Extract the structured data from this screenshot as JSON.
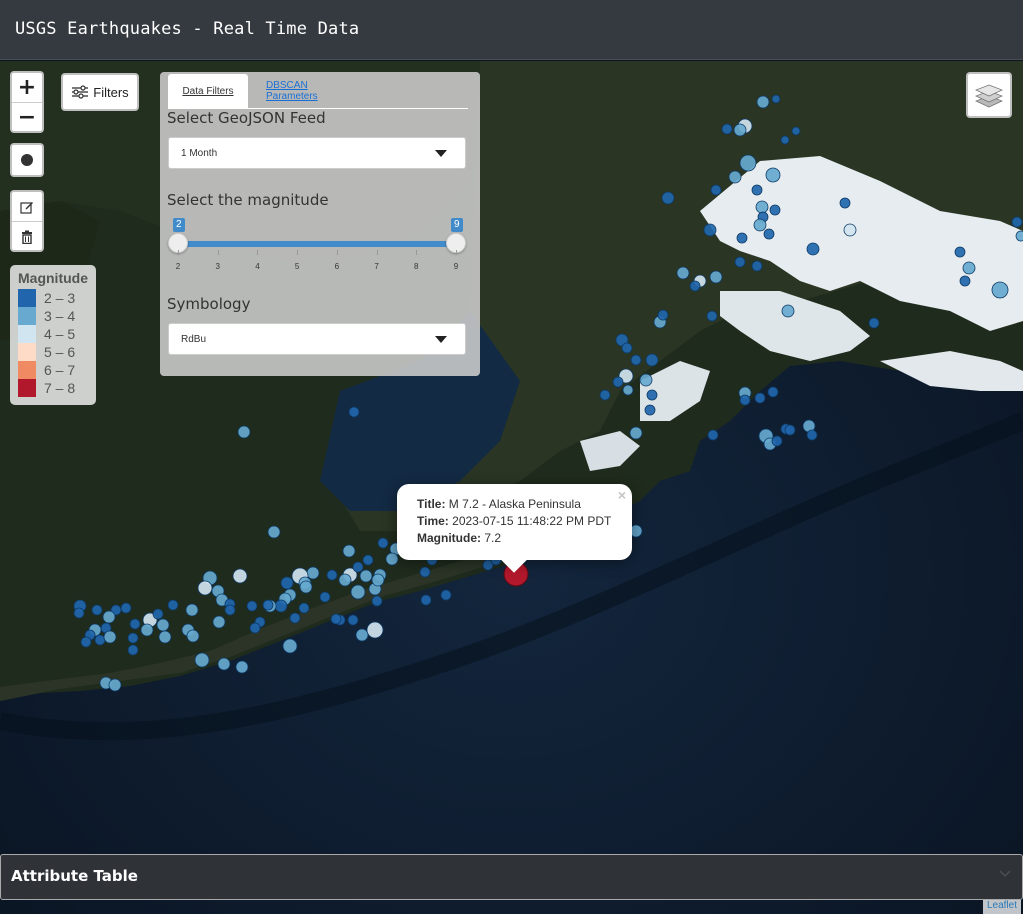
{
  "navbar": {
    "title": "USGS Earthquakes - Real Time Data"
  },
  "map_controls": {
    "zoom_in": "+",
    "zoom_out": "−",
    "filters_label": "Filters"
  },
  "legend": {
    "title": "Magnitude",
    "items": [
      {
        "label": "2 – 3",
        "color": "#2166ac"
      },
      {
        "label": "3 – 4",
        "color": "#67a9cf"
      },
      {
        "label": "4 – 5",
        "color": "#d1e5f0"
      },
      {
        "label": "5 – 6",
        "color": "#fddbc7"
      },
      {
        "label": "6 – 7",
        "color": "#ef8a62"
      },
      {
        "label": "7 – 8",
        "color": "#b2182b"
      }
    ]
  },
  "panel": {
    "tabs": [
      "Data Filters",
      "DBSCAN Parameters"
    ],
    "feed_label": "Select GeoJSON Feed",
    "feed_value": "1 Month",
    "magnitude_label": "Select the magnitude",
    "slider": {
      "min": 2,
      "max": 9,
      "low": 2,
      "high": 9,
      "ticks": [
        "2",
        "3",
        "4",
        "5",
        "6",
        "7",
        "8",
        "9"
      ]
    },
    "symbology_label": "Symbology",
    "symbology_value": "RdBu"
  },
  "popup": {
    "title_key": "Title:",
    "title_val": "M 7.2 - Alaska Peninsula",
    "time_key": "Time:",
    "time_val": "2023-07-15 11:48:22 PM PDT",
    "mag_key": "Magnitude:",
    "mag_val": "7.2",
    "close": "×"
  },
  "attribute_table": {
    "title": "Attribute Table"
  },
  "attribution": "Leaflet"
}
